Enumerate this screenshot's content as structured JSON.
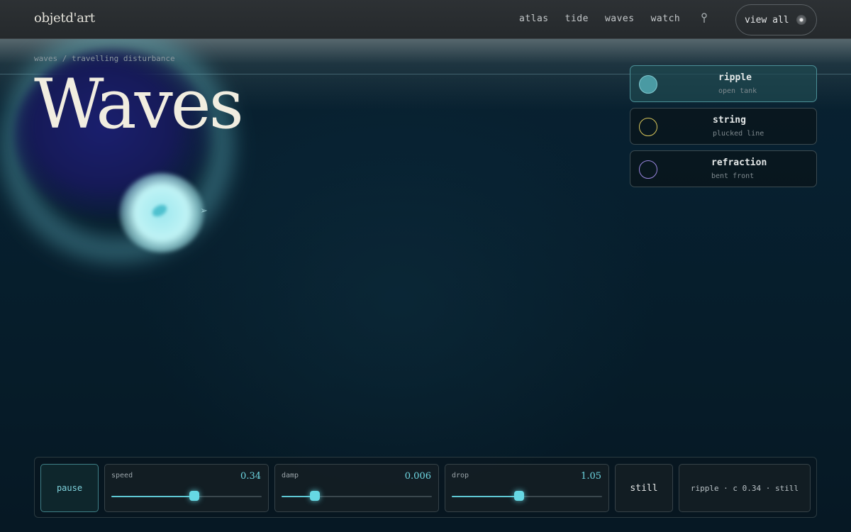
{
  "header": {
    "logo": "objetd'art",
    "nav": [
      "atlas",
      "tide",
      "waves",
      "watch"
    ],
    "view_all_label": "view all"
  },
  "page": {
    "breadcrumb": "waves / travelling disturbance",
    "title": "Waves"
  },
  "presets": [
    {
      "name": "ripple",
      "subtitle": "open tank",
      "color": "#4fa4ad",
      "active": true
    },
    {
      "name": "string",
      "subtitle": "plucked line",
      "color": "#d8c65a",
      "active": false
    },
    {
      "name": "refraction",
      "subtitle": "bent front",
      "color": "#9a86e0",
      "active": false
    }
  ],
  "controls": {
    "pause_label": "pause",
    "sliders": [
      {
        "label": "speed",
        "value": "0.34",
        "fraction": 0.55
      },
      {
        "label": "damp",
        "value": "0.006",
        "fraction": 0.22
      },
      {
        "label": "drop",
        "value": "1.05",
        "fraction": 0.45
      }
    ],
    "still_label": "still",
    "status": "ripple · c 0.34 · still"
  },
  "colors": {
    "accent": "#66d8e4",
    "title": "#f1ede0",
    "background": "#061a26"
  }
}
